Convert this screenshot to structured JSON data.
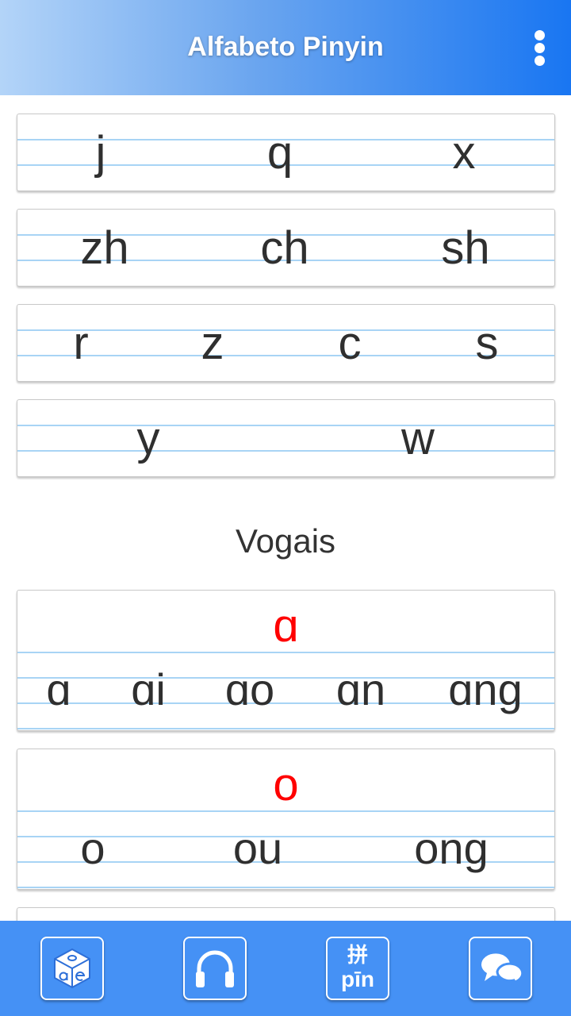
{
  "app": {
    "title": "Alfabeto Pinyin"
  },
  "initials": {
    "rows": [
      [
        "j",
        "q",
        "x"
      ],
      [
        "zh",
        "ch",
        "sh"
      ],
      [
        "r",
        "z",
        "c",
        "s"
      ],
      [
        "y",
        "w"
      ]
    ]
  },
  "vowels": {
    "section_title": "Vogais",
    "groups": [
      {
        "head": "ɑ",
        "items": [
          "ɑ",
          "ɑi",
          "ɑo",
          "ɑn",
          "ɑng"
        ]
      },
      {
        "head": "o",
        "items": [
          "o",
          "ou",
          "ong"
        ]
      }
    ]
  },
  "bottom_nav": {
    "pinyin_button": {
      "hanzi": "拼",
      "pinyin": "pīn"
    }
  },
  "icons": {
    "menu": "more-vert-icon",
    "nav": [
      "alphabet-cube-icon",
      "headphones-icon",
      "pinyin-icon",
      "chat-bubbles-icon"
    ]
  },
  "colors": {
    "header_gradient_start": "#b3d4f8",
    "header_gradient_end": "#1976f2",
    "accent_red": "#ff0000",
    "ruled_line": "#a8d4f5",
    "bottom_bar": "#4591f5"
  }
}
